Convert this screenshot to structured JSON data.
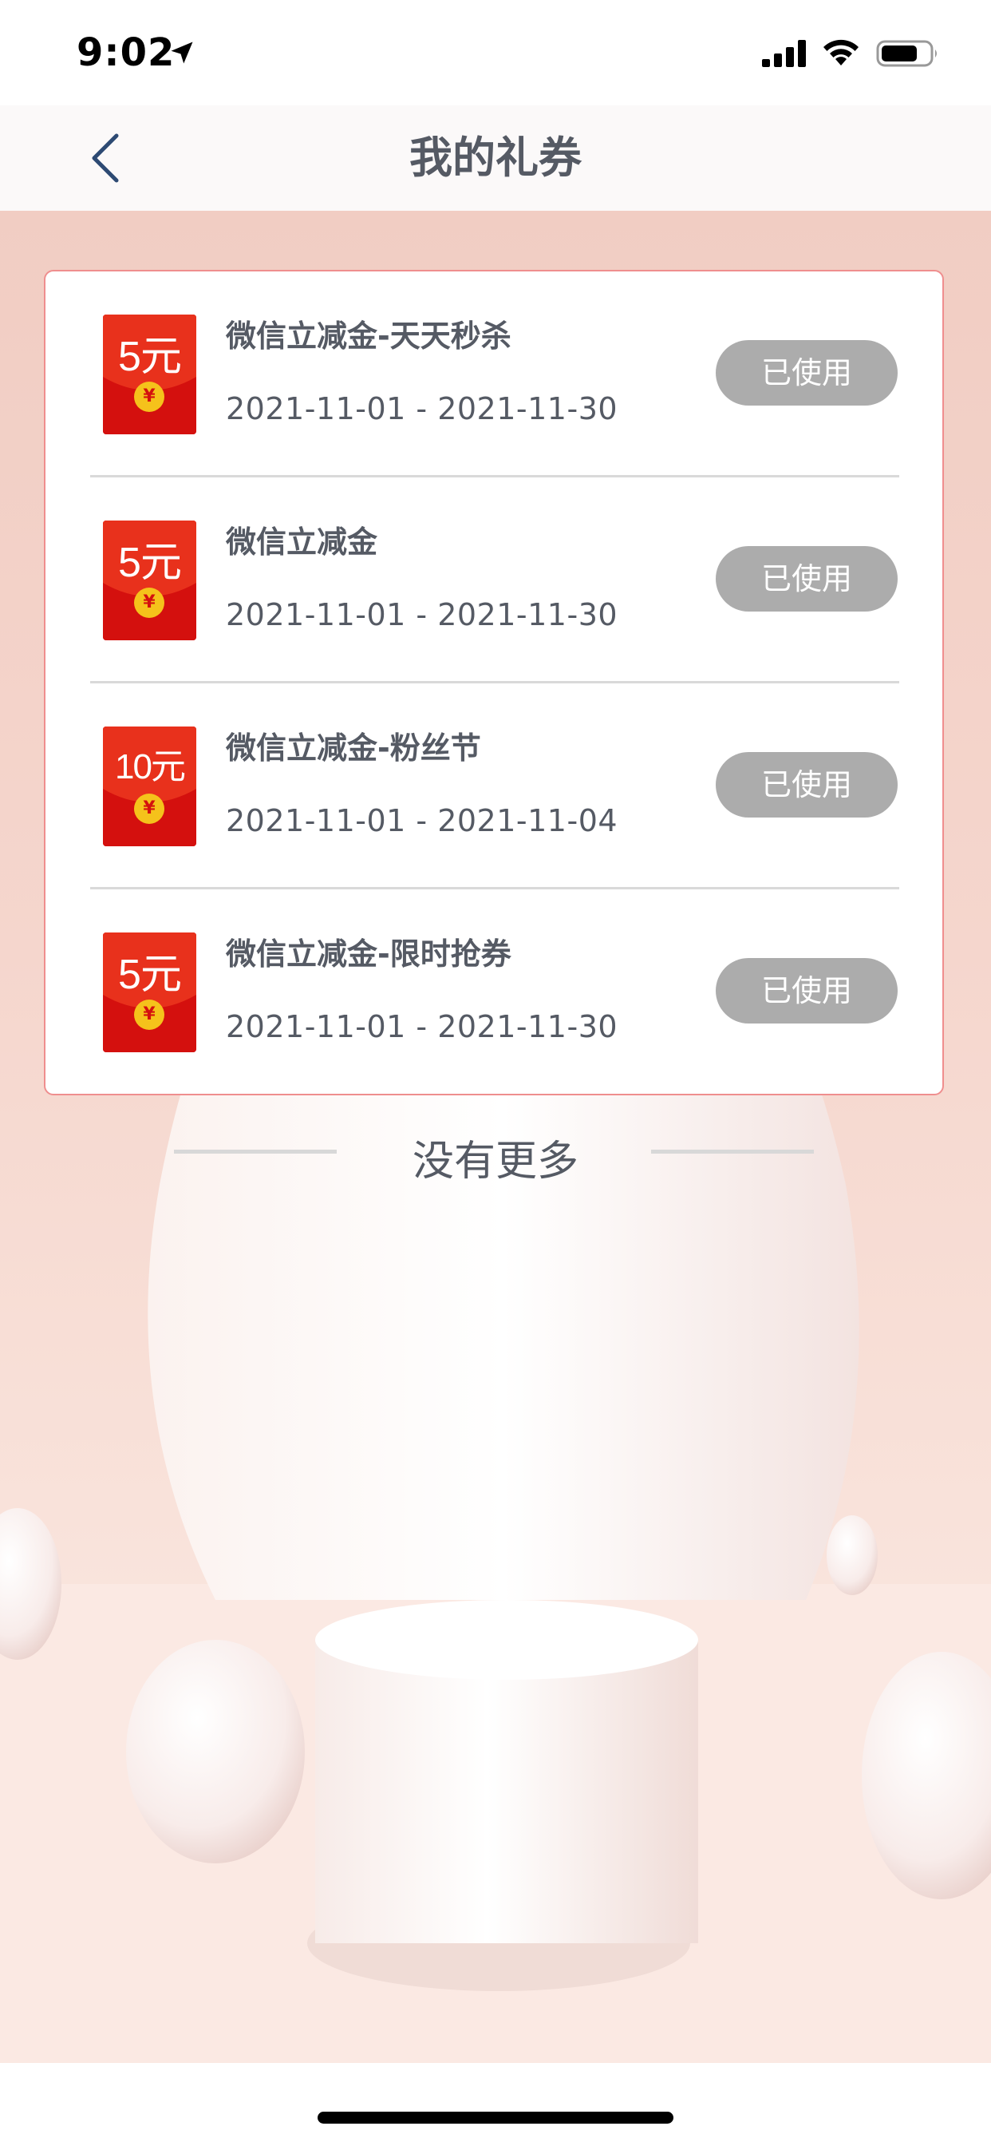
{
  "status_bar": {
    "time": "9:02"
  },
  "header": {
    "title": "我的礼券"
  },
  "coupons": [
    {
      "amount": "5元",
      "name": "微信立减金-天天秒杀",
      "date_range": "2021-11-01 - 2021-11-30",
      "status": "已使用"
    },
    {
      "amount": "5元",
      "name": "微信立减金",
      "date_range": "2021-11-01 - 2021-11-30",
      "status": "已使用"
    },
    {
      "amount": "10元",
      "name": "微信立减金-粉丝节",
      "date_range": "2021-11-01 - 2021-11-04",
      "status": "已使用"
    },
    {
      "amount": "5元",
      "name": "微信立减金-限时抢券",
      "date_range": "2021-11-01 - 2021-11-30",
      "status": "已使用"
    }
  ],
  "coin_symbol": "¥",
  "footer": {
    "no_more": "没有更多"
  },
  "colors": {
    "red_packet": "#d4100e",
    "coin": "#f5c21b",
    "card_border": "#ef8e8e",
    "used_button": "#acacac",
    "text": "#555a64"
  }
}
